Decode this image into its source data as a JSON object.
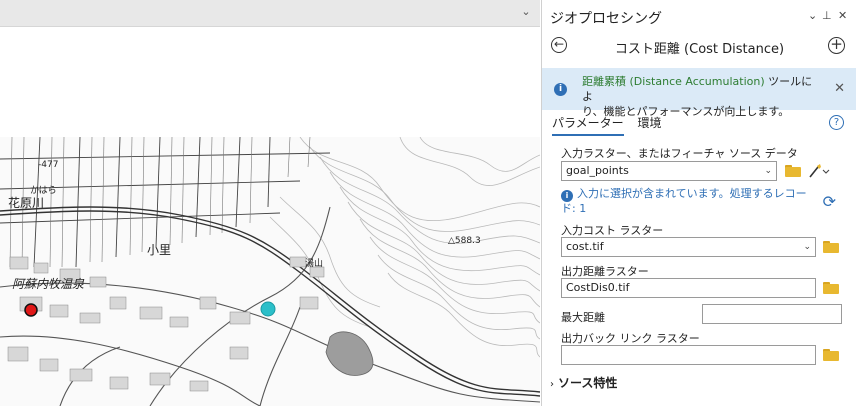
{
  "pane": {
    "title": "ジオプロセシング",
    "ctrl_dropdown": "⌄",
    "ctrl_pin": "⊥",
    "ctrl_close": "✕",
    "tool_title": "コスト距離 (Cost Distance)",
    "back_glyph": "←",
    "add_glyph": "+"
  },
  "banner": {
    "link_text": "距離累積 (Distance Accumulation)",
    "rest_line1": " ツールによ",
    "line2": "り、機能とパフォーマンスが向上します。",
    "close_glyph": "✕",
    "icon_glyph": "i"
  },
  "tabs": {
    "parameters": "パラメーター",
    "environments": "環境",
    "help_glyph": "?"
  },
  "params": {
    "input_label": "入力ラスター、またはフィーチャ ソース データ",
    "input_value": "goal_points",
    "selection_notice": "入力に選択が含まれています。処理するレコード: 1",
    "cost_label": "入力コスト ラスター",
    "cost_value": "cost.tif",
    "output_label": "出力距離ラスター",
    "output_value": "CostDis0.tif",
    "max_distance_label": "最大距離",
    "max_distance_value": "",
    "backlink_label": "出力バック リンク ラスター",
    "backlink_value": "",
    "dropdown_glyph": "⌄"
  },
  "section": {
    "label": "ソース特性",
    "arrow": "›"
  },
  "map": {
    "labels": {
      "label_477": "-477",
      "kahara": "かはら",
      "haranogawa": "花原川",
      "onsen": "阿蘇内牧温泉",
      "kosato": "小里",
      "yuyama": "湯山",
      "elev": "△588.3"
    },
    "colors": {
      "goal_point": "#e01818",
      "source_point": "#2bbfc9"
    }
  }
}
